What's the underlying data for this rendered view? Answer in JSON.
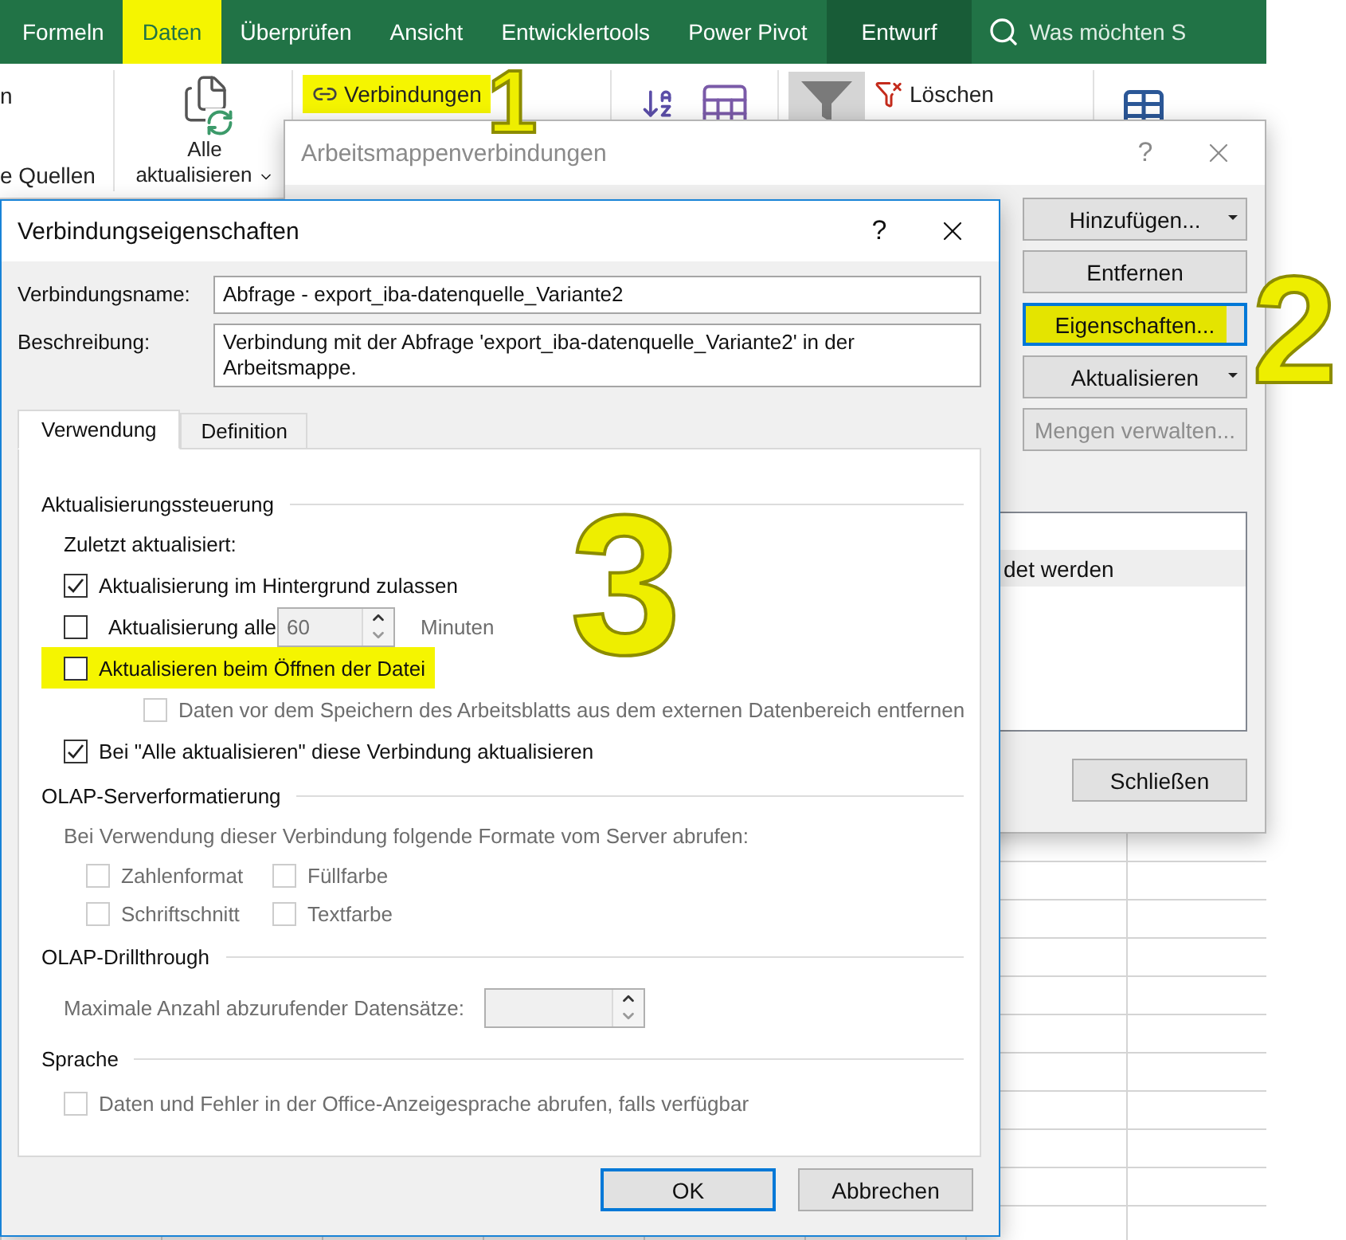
{
  "ribbon": {
    "tabs": [
      {
        "label": "Formeln",
        "selected": false,
        "highlighted": false,
        "kind": "standard"
      },
      {
        "label": "Daten",
        "selected": true,
        "highlighted": true,
        "kind": "standard"
      },
      {
        "label": "Überprüfen",
        "selected": false,
        "highlighted": false,
        "kind": "standard"
      },
      {
        "label": "Ansicht",
        "selected": false,
        "highlighted": false,
        "kind": "standard"
      },
      {
        "label": "Entwicklertools",
        "selected": false,
        "highlighted": false,
        "kind": "standard"
      },
      {
        "label": "Power Pivot",
        "selected": false,
        "highlighted": false,
        "kind": "standard"
      },
      {
        "label": "Entwurf",
        "selected": false,
        "highlighted": false,
        "kind": "contextual"
      }
    ],
    "search": {
      "placeholder": "Was möchten S"
    },
    "left_group": {
      "line_1": "n",
      "line_2": "e Quellen"
    },
    "refresh_all": {
      "label": "Alle aktualisieren"
    },
    "connections": {
      "label": "Verbindungen",
      "highlighted": true
    },
    "clear": {
      "label": "Löschen"
    }
  },
  "workbook_connections_dialog": {
    "title": "Arbeitsmappenverbindungen",
    "help": "?",
    "buttons": [
      {
        "label": "Hinzufügen...",
        "dropdown": true,
        "focused": false,
        "highlighted": false,
        "disabled": false
      },
      {
        "label": "Entfernen",
        "dropdown": false,
        "focused": false,
        "highlighted": false,
        "disabled": false
      },
      {
        "label": "Eigenschaften...",
        "dropdown": false,
        "focused": true,
        "highlighted": true,
        "disabled": false
      },
      {
        "label": "Aktualisieren",
        "dropdown": true,
        "focused": false,
        "highlighted": false,
        "disabled": false
      },
      {
        "label": "Mengen verwalten...",
        "dropdown": false,
        "focused": false,
        "highlighted": false,
        "disabled": true
      }
    ],
    "list_rows": [
      {
        "text": "det werden",
        "selected": true
      }
    ],
    "close_button": "Schließen"
  },
  "connection_properties_dialog": {
    "title": "Verbindungseigenschaften",
    "help": "?",
    "name_label": "Verbindungsname:",
    "name_value": "Abfrage - export_iba-datenquelle_Variante2",
    "description_label": "Beschreibung:",
    "description_value": "Verbindung mit der Abfrage 'export_iba-datenquelle_Variante2' in der Arbeitsmappe.",
    "tabs": [
      {
        "label": "Verwendung",
        "selected": true
      },
      {
        "label": "Definition",
        "selected": false
      }
    ],
    "refresh_control": {
      "title": "Aktualisierungssteuerung",
      "last_refreshed": "Zuletzt aktualisiert:",
      "options": [
        {
          "kind": "checkbox",
          "label": "Aktualisierung im Hintergrund zulassen",
          "checked": true,
          "disabled": false,
          "highlighted": false
        },
        {
          "kind": "interval",
          "label": "Aktualisierung alle",
          "checked": false,
          "disabled": false,
          "highlighted": false,
          "value": "60",
          "value_disabled": true,
          "unit": "Minuten"
        },
        {
          "kind": "checkbox",
          "label": "Aktualisieren beim Öffnen der Datei",
          "checked": false,
          "disabled": false,
          "highlighted": true,
          "children": [
            {
              "kind": "checkbox",
              "label": "Daten vor dem Speichern des Arbeitsblatts aus dem externen Datenbereich entfernen",
              "checked": false,
              "disabled": true,
              "highlighted": false
            }
          ]
        },
        {
          "kind": "checkbox",
          "label": "Bei \"Alle aktualisieren\" diese Verbindung aktualisieren",
          "checked": true,
          "disabled": false,
          "highlighted": false
        }
      ]
    },
    "olap_formatting": {
      "title": "OLAP-Serverformatierung",
      "description": "Bei Verwendung dieser Verbindung folgende Formate vom Server abrufen:",
      "options": [
        {
          "label": "Zahlenformat",
          "checked": false,
          "disabled": true
        },
        {
          "label": "Füllfarbe",
          "checked": false,
          "disabled": true
        },
        {
          "label": "Schriftschnitt",
          "checked": false,
          "disabled": true
        },
        {
          "label": "Textfarbe",
          "checked": false,
          "disabled": true
        }
      ]
    },
    "olap_drillthrough": {
      "title": "OLAP-Drillthrough",
      "label": "Maximale Anzahl abzurufender Datensätze:",
      "disabled": true
    },
    "language": {
      "title": "Sprache",
      "options": [
        {
          "label": "Daten und Fehler in der Office-Anzeigesprache abrufen, falls verfügbar",
          "checked": false,
          "disabled": true
        }
      ]
    },
    "ok_button": {
      "label": "OK",
      "focused": true
    },
    "cancel_button": {
      "label": "Abbrechen",
      "focused": false
    }
  },
  "annotations": [
    {
      "label": "1"
    },
    {
      "label": "2"
    },
    {
      "label": "3"
    }
  ]
}
